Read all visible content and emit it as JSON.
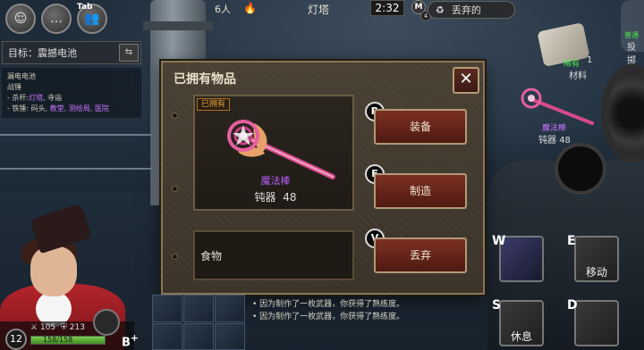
{
  "hud": {
    "tab_key": "Tab",
    "players": "6人",
    "map_name": "灯塔",
    "timer": "2:32",
    "map_key": "M",
    "map_count": "4",
    "discard_label": "丢弃的"
  },
  "objective": {
    "label": "目标：震撼电池",
    "quest_title": "漏电电池",
    "line1": "战锤",
    "line2_prefix": "- 杀杆:",
    "line2_hl": "灯塔",
    "line2_suffix": ", 寺庙",
    "line3_prefix": "- 铁锤: 码头, ",
    "line3_hl": "教堂, 测绘局, 医院"
  },
  "side_items": {
    "material_green": "稀有",
    "material_count": "1",
    "material_label": "材料",
    "throw_label": "投掷",
    "throw_green": "普通",
    "wand_name": "魔法棒",
    "wand_type": "钝器",
    "wand_value": "48"
  },
  "modal": {
    "title": "已拥有物品",
    "close": "✕",
    "owned_tag": "已拥有",
    "item_name": "魔法棒",
    "item_type": "钝器",
    "item_value": "48",
    "food_label": "食物",
    "buttons": [
      {
        "key": "R",
        "label": "装备"
      },
      {
        "key": "F",
        "label": "制造"
      },
      {
        "key": "V",
        "label": "丢弃"
      }
    ]
  },
  "player": {
    "level": "12",
    "attack": "105",
    "defense": "213",
    "hp_text": "158/158",
    "hp_fraction": 1.0,
    "br_label": "B"
  },
  "chat_log": [
    "因为制作了一枚武器，你获得了熟练度。",
    "因为制作了一枚武器，你获得了熟练度。"
  ],
  "skills": [
    {
      "key": "W",
      "label": ""
    },
    {
      "key": "E",
      "label": "移动"
    },
    {
      "key": "S",
      "label": "休息"
    },
    {
      "key": "D",
      "label": ""
    }
  ],
  "colors": {
    "purple_rare": "#b860ff",
    "button_red": "#7c2f22",
    "frame_gold": "#8a7656"
  }
}
